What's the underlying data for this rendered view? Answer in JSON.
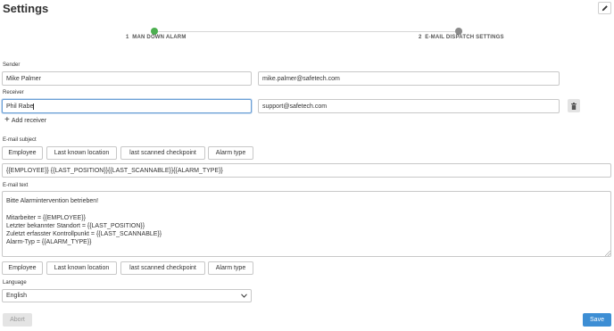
{
  "header": {
    "title": "Settings",
    "edit_icon": "pencil-icon"
  },
  "stepper": {
    "steps": [
      {
        "number": "1",
        "label": "MAN DOWN ALARM",
        "status": "completed",
        "color": "#4caf50"
      },
      {
        "number": "2",
        "label": "E-MAIL DISPATCH SETTINGS",
        "status": "pending",
        "color": "#8a8a8a"
      }
    ]
  },
  "sender": {
    "label": "Sender",
    "name": "Mike Palmer",
    "email": "mike.palmer@safetech.com"
  },
  "receiver": {
    "label": "Receiver",
    "name": "Phil Rabe",
    "email": "support@safetech.com",
    "remove_icon": "trash-icon"
  },
  "add_receiver": {
    "icon": "plus-icon",
    "label": "Add receiver"
  },
  "subject": {
    "label": "E-mail subject",
    "tags": [
      "Employee",
      "Last known location",
      "last scanned checkpoint",
      "Alarm type"
    ],
    "value": "{{EMPLOYEE}} {{LAST_POSITION}}{{LAST_SCANNABLE}}{{ALARM_TYPE}}"
  },
  "body": {
    "label": "E-mail text",
    "lines": [
      "Bitte Alarmintervention betrieben!",
      "",
      "Mitarbeiter = {{EMPLOYEE}}",
      "Letzter bekannter Standort = {{LAST_POSITION}}",
      "Zuletzt erfasster Kontrollpunkt = {{LAST_SCANNABLE}}",
      "Alarm-Typ = {{ALARM_TYPE}}"
    ],
    "tags": [
      "Employee",
      "Last known location",
      "last scanned checkpoint",
      "Alarm type"
    ]
  },
  "language": {
    "label": "Language",
    "selected": "English"
  },
  "footer": {
    "abort_label": "Abort",
    "save_label": "Save"
  },
  "colors": {
    "accent": "#3d8ed4",
    "step_done": "#4caf50",
    "step_pending": "#8a8a8a",
    "focus": "#6a9fd6"
  }
}
